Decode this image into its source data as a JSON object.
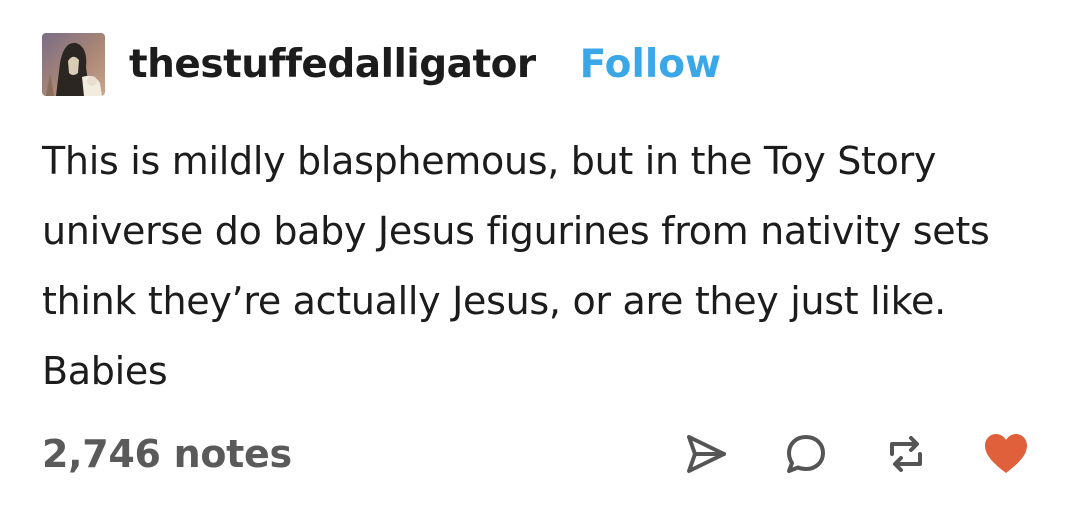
{
  "post": {
    "username": "thestuffedalligator",
    "follow_label": "Follow",
    "body": "This is mildly blasphemous, but in the Toy Story universe do baby Jesus figurines from nativity sets think they’re actually Jesus, or are they just like. Babies",
    "notes": "2,746 notes"
  },
  "actions": [
    {
      "icon": "share-icon"
    },
    {
      "icon": "reply-icon"
    },
    {
      "icon": "reblog-icon"
    },
    {
      "icon": "heart-icon"
    }
  ],
  "colors": {
    "follow": "#3aa8e8",
    "heart": "#e0603c",
    "icon": "#555555",
    "text": "#1c1c1c"
  }
}
